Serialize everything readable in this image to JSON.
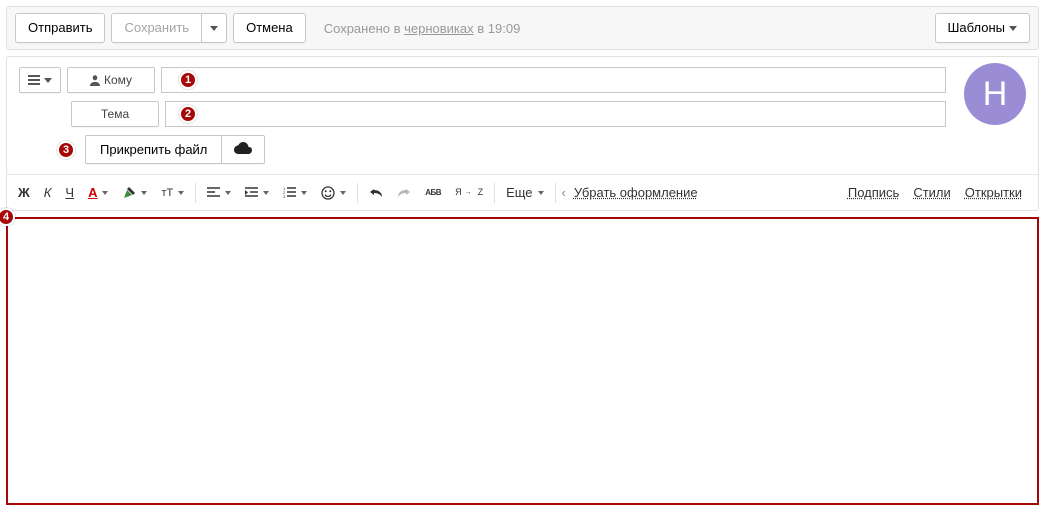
{
  "toolbar": {
    "send": "Отправить",
    "save": "Сохранить",
    "cancel": "Отмена",
    "status_prefix": "Сохранено в ",
    "status_drafts": "черновиках",
    "status_suffix": " в 19:09",
    "templates": "Шаблоны"
  },
  "compose": {
    "to_label": "Кому",
    "subject_label": "Тема",
    "attach_label": "Прикрепить файл",
    "avatar_letter": "Н"
  },
  "markers": {
    "m1": "1",
    "m2": "2",
    "m3": "3",
    "m4": "4"
  },
  "format": {
    "bold": "Ж",
    "italic": "К",
    "underline": "Ч",
    "textcolor": "A",
    "size": "тТ",
    "spellcheck": "АБВ",
    "translate": "Я",
    "translate2": "Z",
    "more": "Еще",
    "clear": "Убрать оформление",
    "signature": "Подпись",
    "styles": "Стили",
    "postcards": "Открытки"
  }
}
